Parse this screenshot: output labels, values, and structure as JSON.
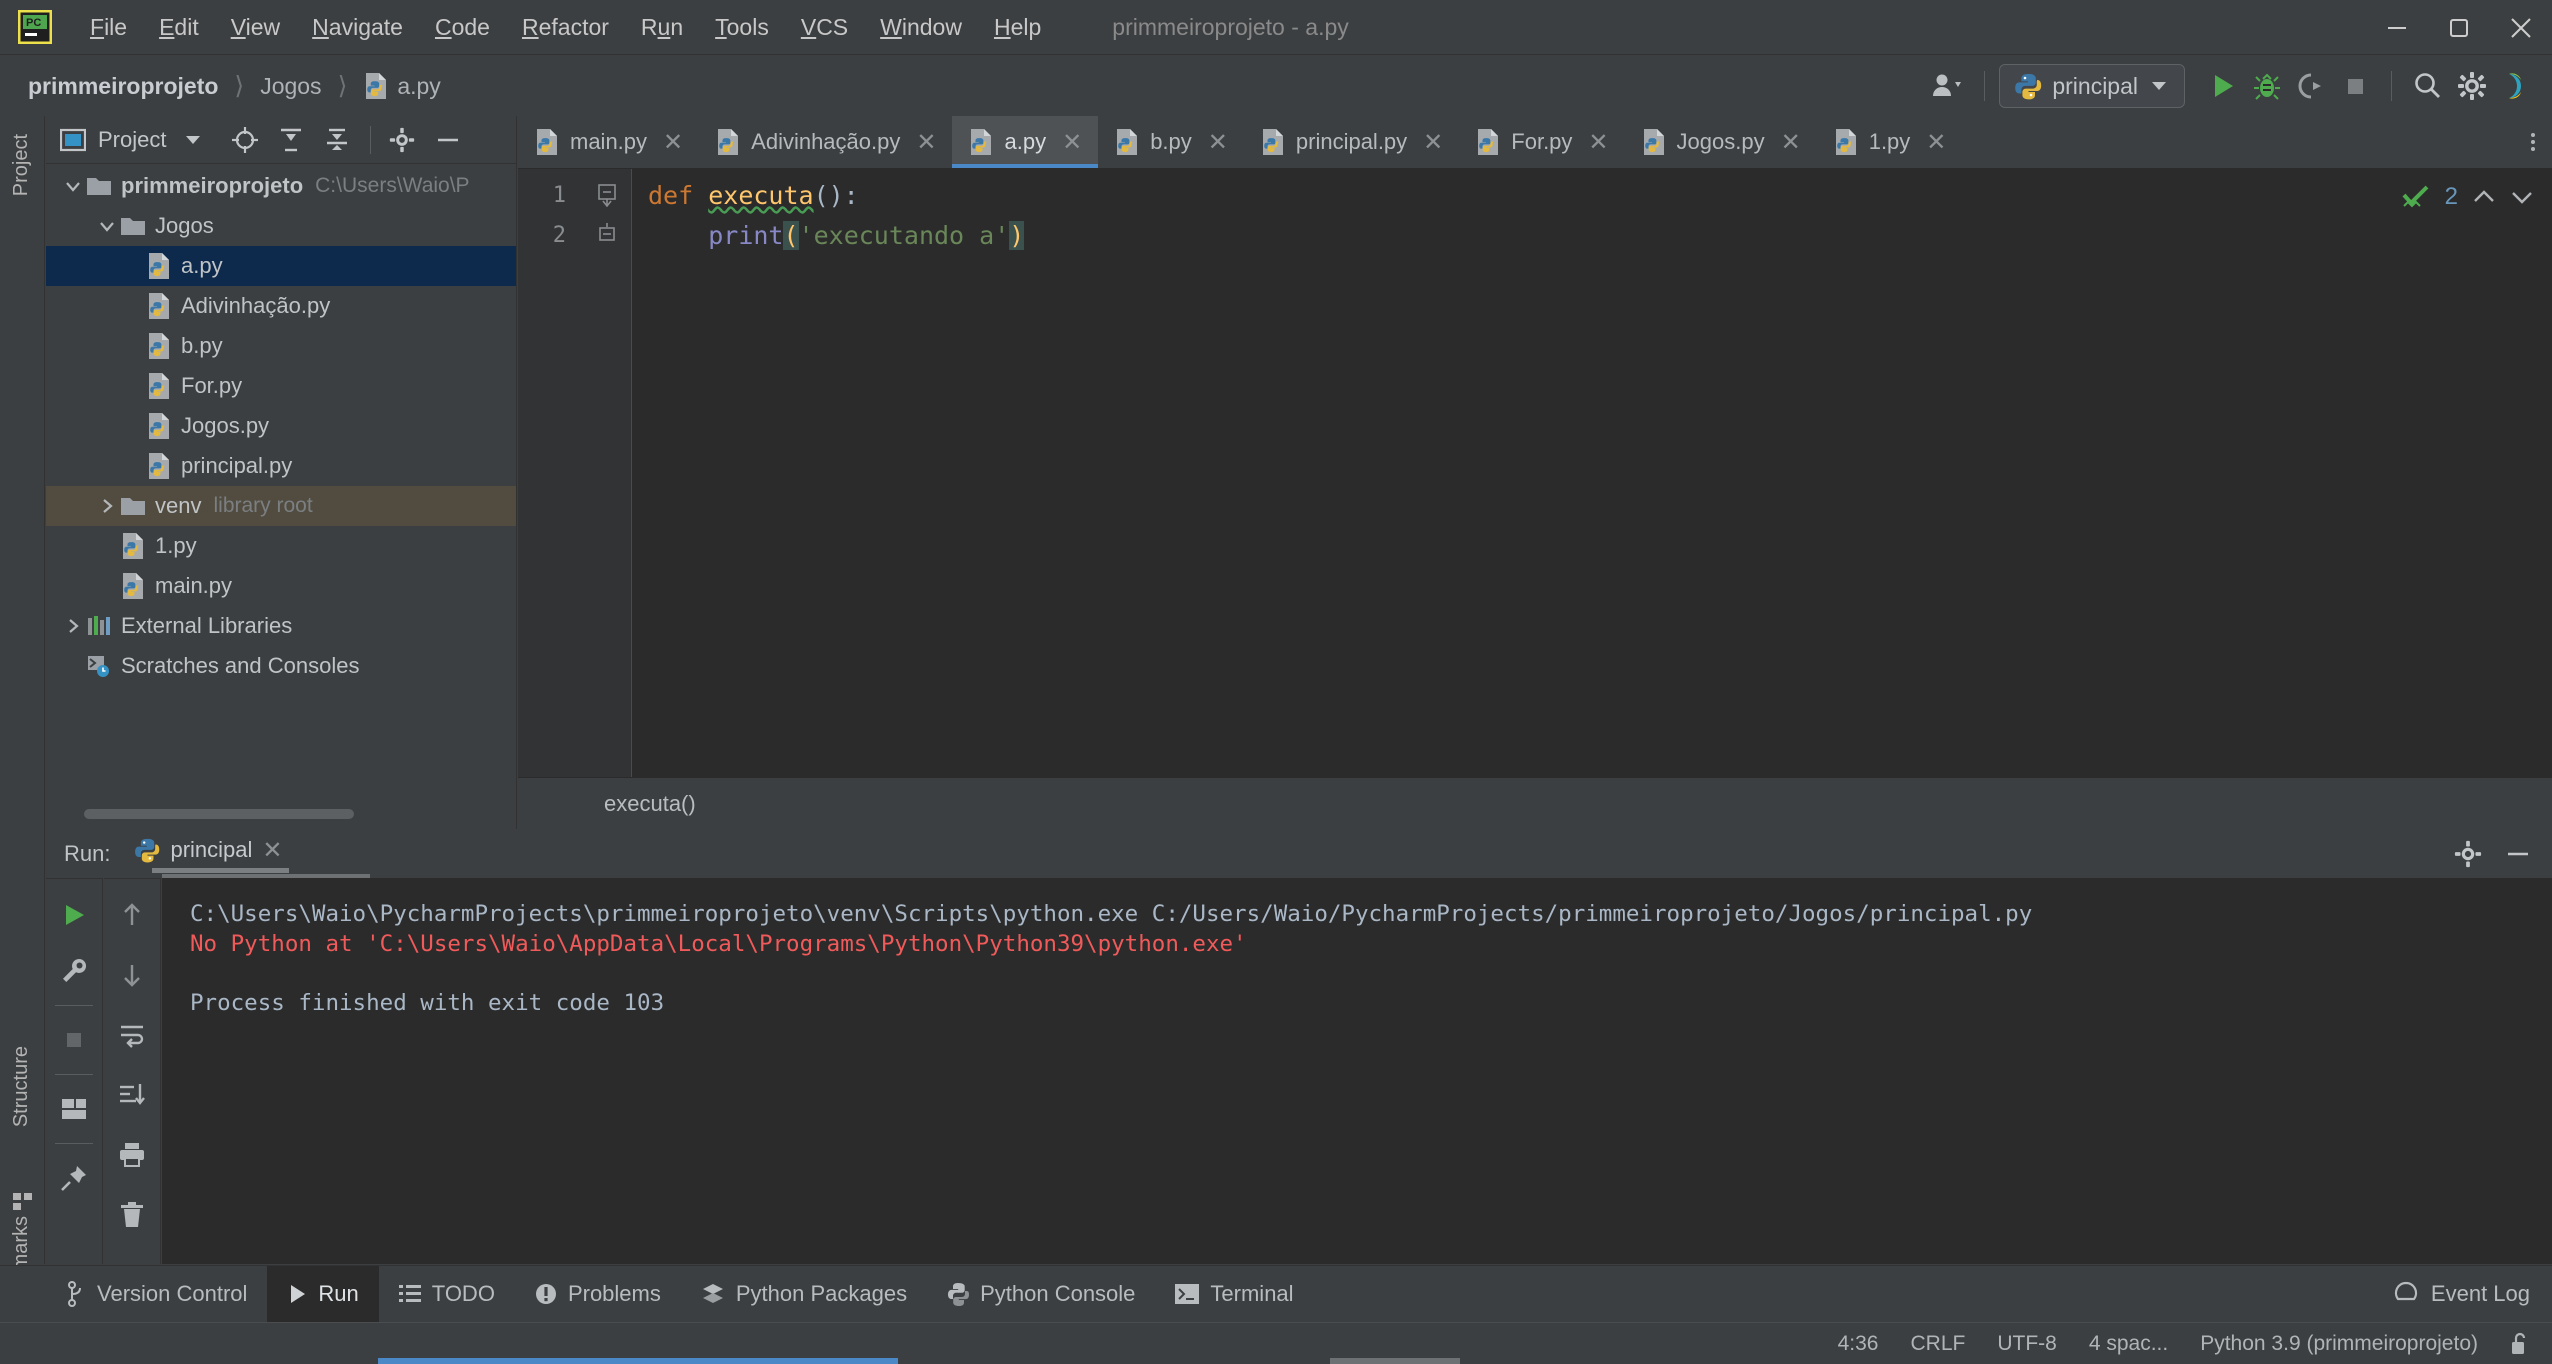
{
  "window": {
    "title": "primmeiroprojeto - a.py",
    "logo_icon": "pycharm-logo-icon",
    "minimize_icon": "minimize-icon",
    "maximize_icon": "maximize-icon",
    "close_icon": "close-icon"
  },
  "menu": [
    {
      "label": "File",
      "mnemonic": "F"
    },
    {
      "label": "Edit",
      "mnemonic": "E"
    },
    {
      "label": "View",
      "mnemonic": "V"
    },
    {
      "label": "Navigate",
      "mnemonic": "N"
    },
    {
      "label": "Code",
      "mnemonic": "C"
    },
    {
      "label": "Refactor",
      "mnemonic": "R"
    },
    {
      "label": "Run",
      "mnemonic": "u"
    },
    {
      "label": "Tools",
      "mnemonic": "T"
    },
    {
      "label": "VCS",
      "mnemonic": "V"
    },
    {
      "label": "Window",
      "mnemonic": "W"
    },
    {
      "label": "Help",
      "mnemonic": "H"
    }
  ],
  "breadcrumbs": [
    {
      "label": "primmeiroprojeto",
      "bold": true,
      "icon": ""
    },
    {
      "label": "Jogos",
      "bold": false,
      "icon": ""
    },
    {
      "label": "a.py",
      "bold": false,
      "icon": "python-file-icon"
    }
  ],
  "toolbar": {
    "account_icon": "account-icon",
    "run_config": {
      "label": "principal",
      "icon": "python-icon",
      "chevron": "chevron-down-icon"
    },
    "run_icon": "run-icon",
    "debug_icon": "debug-icon",
    "coverage_icon": "run-with-coverage-icon",
    "stop_icon": "stop-icon",
    "search_icon": "search-icon",
    "settings_icon": "gear-icon",
    "ai_icon": "ai-assistant-icon"
  },
  "left_strip": {
    "project": "Project",
    "structure": "Structure",
    "bookmarks": "Bookmarks",
    "bookmark_icon": "bookmark-icon",
    "structure_icon": "structure-icon"
  },
  "project_panel": {
    "title": "Project",
    "title_icon": "project-view-icon",
    "chevron_icon": "chevron-down-icon",
    "locate_icon": "scroll-from-source-icon",
    "expand_icon": "expand-all-icon",
    "collapse_icon": "collapse-all-icon",
    "settings_icon": "gear-icon",
    "hide_icon": "hide-icon",
    "tree": [
      {
        "label": "primmeiroprojeto",
        "suffix": "C:\\Users\\Waio\\P",
        "depth": 0,
        "twisty": "expanded",
        "icon": "folder-icon",
        "bold": true,
        "state": "normal"
      },
      {
        "label": "Jogos",
        "suffix": "",
        "depth": 1,
        "twisty": "expanded",
        "icon": "folder-icon",
        "bold": false,
        "state": "normal"
      },
      {
        "label": "a.py",
        "suffix": "",
        "depth": 2,
        "twisty": "none",
        "icon": "python-file-icon",
        "bold": false,
        "state": "selected"
      },
      {
        "label": "Adivinhação.py",
        "suffix": "",
        "depth": 2,
        "twisty": "none",
        "icon": "python-file-icon",
        "bold": false,
        "state": "normal"
      },
      {
        "label": "b.py",
        "suffix": "",
        "depth": 2,
        "twisty": "none",
        "icon": "python-file-icon",
        "bold": false,
        "state": "normal"
      },
      {
        "label": "For.py",
        "suffix": "",
        "depth": 2,
        "twisty": "none",
        "icon": "python-file-icon",
        "bold": false,
        "state": "normal"
      },
      {
        "label": "Jogos.py",
        "suffix": "",
        "depth": 2,
        "twisty": "none",
        "icon": "python-file-icon",
        "bold": false,
        "state": "normal"
      },
      {
        "label": "principal.py",
        "suffix": "",
        "depth": 2,
        "twisty": "none",
        "icon": "python-file-icon",
        "bold": false,
        "state": "normal"
      },
      {
        "label": "venv",
        "suffix": "library root",
        "depth": 1,
        "twisty": "collapsed",
        "icon": "folder-icon",
        "bold": false,
        "state": "inactive-selected"
      },
      {
        "label": "1.py",
        "suffix": "",
        "depth": 1,
        "twisty": "none",
        "icon": "python-file-icon",
        "bold": false,
        "state": "normal"
      },
      {
        "label": "main.py",
        "suffix": "",
        "depth": 1,
        "twisty": "none",
        "icon": "python-file-icon",
        "bold": false,
        "state": "normal"
      },
      {
        "label": "External Libraries",
        "suffix": "",
        "depth": 0,
        "twisty": "collapsed",
        "icon": "libraries-icon",
        "bold": false,
        "state": "normal"
      },
      {
        "label": "Scratches and Consoles",
        "suffix": "",
        "depth": 0,
        "twisty": "none",
        "icon": "scratches-icon",
        "bold": false,
        "state": "normal"
      }
    ]
  },
  "editor": {
    "tabs": [
      {
        "label": "main.py",
        "icon": "python-file-icon",
        "active": false
      },
      {
        "label": "Adivinhação.py",
        "icon": "python-file-icon",
        "active": false
      },
      {
        "label": "a.py",
        "icon": "python-file-icon",
        "active": true
      },
      {
        "label": "b.py",
        "icon": "python-file-icon",
        "active": false
      },
      {
        "label": "principal.py",
        "icon": "python-file-icon",
        "active": false
      },
      {
        "label": "For.py",
        "icon": "python-file-icon",
        "active": false
      },
      {
        "label": "Jogos.py",
        "icon": "python-file-icon",
        "active": false
      },
      {
        "label": "1.py",
        "icon": "python-file-icon",
        "active": false
      }
    ],
    "tab_close_icon": "close-icon",
    "overflow_icon": "more-icon",
    "line_numbers": [
      "1",
      "2"
    ],
    "code": {
      "line1": {
        "kw": "def ",
        "fn": "executa",
        "tail": "():"
      },
      "line2": {
        "indent": "    ",
        "fn": "print",
        "open": "(",
        "str": "'executando a'",
        "close": ")"
      }
    },
    "breadcrumb": "executa()",
    "inspections": {
      "count": "2",
      "check_icon": "inspection-ok-icon",
      "up_icon": "chevron-up-icon",
      "down_icon": "chevron-down-icon"
    }
  },
  "run_panel": {
    "label": "Run:",
    "tab_label": "principal",
    "tab_icon": "python-icon",
    "tab_close_icon": "close-icon",
    "settings_icon": "gear-icon",
    "hide_icon": "hide-icon",
    "tools_col1": [
      {
        "name": "rerun-icon"
      },
      {
        "name": "wrench-icon"
      },
      {
        "name": "stop-icon"
      },
      {
        "name": "layout-icon"
      },
      {
        "name": "pin-icon"
      }
    ],
    "tools_col2": [
      {
        "name": "arrow-up-icon"
      },
      {
        "name": "arrow-down-icon"
      },
      {
        "name": "soft-wrap-icon"
      },
      {
        "name": "scroll-to-end-icon"
      },
      {
        "name": "print-icon"
      },
      {
        "name": "trash-icon"
      }
    ],
    "console": [
      {
        "text": "C:\\Users\\Waio\\PycharmProjects\\primmeiroprojeto\\venv\\Scripts\\python.exe C:/Users/Waio/PycharmProjects/primmeiroprojeto/Jogos/principal.py",
        "type": "normal"
      },
      {
        "text": "No Python at 'C:\\Users\\Waio\\AppData\\Local\\Programs\\Python\\Python39\\python.exe'",
        "type": "error"
      },
      {
        "text": "",
        "type": "normal"
      },
      {
        "text": "Process finished with exit code 103",
        "type": "normal"
      }
    ]
  },
  "bottom_bar": {
    "items": [
      {
        "label": "Version Control",
        "icon": "branch-icon",
        "active": false
      },
      {
        "label": "Run",
        "icon": "run-icon",
        "active": true
      },
      {
        "label": "TODO",
        "icon": "todo-icon",
        "active": false
      },
      {
        "label": "Problems",
        "icon": "problems-icon",
        "active": false
      },
      {
        "label": "Python Packages",
        "icon": "packages-icon",
        "active": false
      },
      {
        "label": "Python Console",
        "icon": "python-console-icon",
        "active": false
      },
      {
        "label": "Terminal",
        "icon": "terminal-icon",
        "active": false
      }
    ],
    "event_log": {
      "label": "Event Log",
      "icon": "event-log-icon"
    }
  },
  "status_bar": {
    "caret": "4:36",
    "line_separator": "CRLF",
    "encoding": "UTF-8",
    "indent": "4 spac...",
    "interpreter": "Python 3.9 (primmeiroprojeto)",
    "lock_icon": "unlocked-icon"
  },
  "colors": {
    "background": "#3c3f41",
    "editor_bg": "#2b2b2b",
    "selection": "#0d2a4d",
    "accent": "#4a88c7",
    "error": "#f05a5a",
    "run_green": "#499c54",
    "keyword_orange": "#cc7832",
    "string_green": "#6a8759",
    "function_yellow": "#ffc66d"
  }
}
